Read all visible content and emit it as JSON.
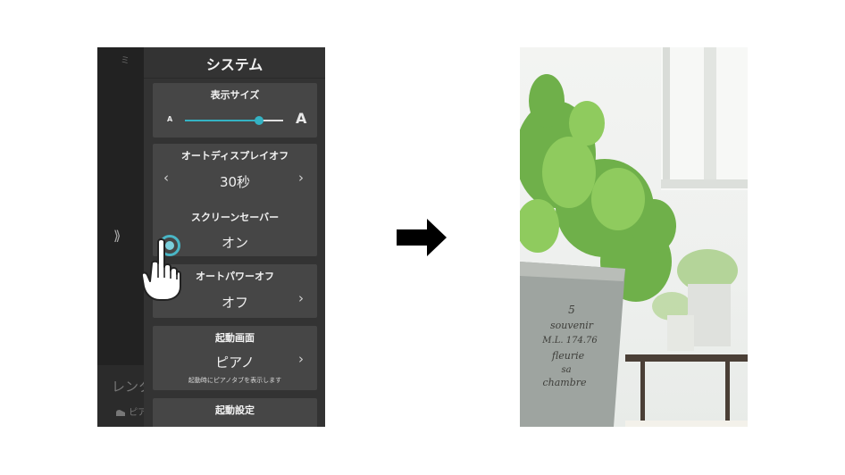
{
  "left_screen": {
    "background_text": {
      "top_char": "ミ",
      "chevron": "⟫",
      "section_label": "レンタ",
      "sub_label": "ピア"
    },
    "panel_title": "システム",
    "display_size": {
      "title": "表示サイズ",
      "small_label": "A",
      "large_label": "A",
      "slider_value_fraction": 0.75
    },
    "auto_display_off": {
      "title": "オートディスプレイオフ",
      "value": "30秒",
      "prev": "‹",
      "next": "›"
    },
    "screen_saver": {
      "title": "スクリーンセーバー",
      "value": "オン"
    },
    "auto_power_off": {
      "title": "オートパワーオフ",
      "value": "オフ",
      "next": "›"
    },
    "startup_screen": {
      "title": "起動画面",
      "value": "ピアノ",
      "next": "›",
      "note": "起動時にピアノタブを表示します"
    },
    "startup_settings": {
      "title": "起動設定"
    },
    "accent_color": "#34b3c4"
  },
  "arrow": {
    "icon": "right-arrow-icon",
    "color": "#000000"
  },
  "right_photo": {
    "pot_text": [
      "5",
      "souvenir",
      "M.L. 174.76",
      "fleurie",
      "sa",
      "chambre"
    ]
  }
}
